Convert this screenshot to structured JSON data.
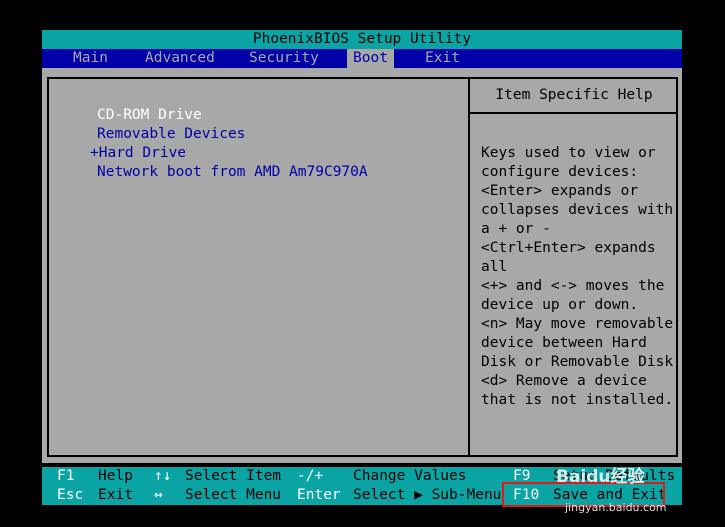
{
  "window": {
    "title": "PhoenixBIOS Setup Utility"
  },
  "menu": {
    "tabs": [
      {
        "label": "Main"
      },
      {
        "label": "Advanced"
      },
      {
        "label": "Security"
      },
      {
        "label": "Boot"
      },
      {
        "label": "Exit"
      }
    ],
    "active_tab": "Boot"
  },
  "boot_order": {
    "items": [
      {
        "label": "CD-ROM Drive"
      },
      {
        "label": "Removable Devices"
      },
      {
        "label": "+Hard Drive"
      },
      {
        "label": "Network boot from AMD Am79C970A"
      }
    ],
    "selected_item": "CD-ROM Drive"
  },
  "help": {
    "title": "Item Specific Help",
    "lines": [
      "Keys used to view or",
      "configure devices:",
      "<Enter> expands or",
      "collapses devices with",
      "a + or -",
      "<Ctrl+Enter> expands",
      "all",
      "<+> and <-> moves the",
      "device up or down.",
      "<n> May move removable",
      "device between Hard",
      "Disk or Removable Disk",
      "<d> Remove a device",
      "that is not installed."
    ]
  },
  "footer": {
    "row1": [
      {
        "key": "F1",
        "action": "Help"
      },
      {
        "key": "↑↓",
        "action": "Select Item"
      },
      {
        "key": "-/+",
        "action": "Change Values"
      },
      {
        "key": "F9",
        "action": "Setup Defaults"
      }
    ],
    "row2": [
      {
        "key": "Esc",
        "action": "Exit"
      },
      {
        "key": "↔",
        "action": "Select Menu"
      },
      {
        "key": "Enter",
        "action": "Select ▶ Sub-Menu"
      },
      {
        "key": "F10",
        "action": "Save and Exit"
      }
    ]
  },
  "watermark": {
    "brand": "Baidu经验",
    "url": "jingyan.baidu.com"
  },
  "colors": {
    "menu_bar": "#0000a8",
    "title_bar": "#0aa4a4",
    "panel": "#a8a8a8",
    "highlight_box": "#e41818"
  }
}
